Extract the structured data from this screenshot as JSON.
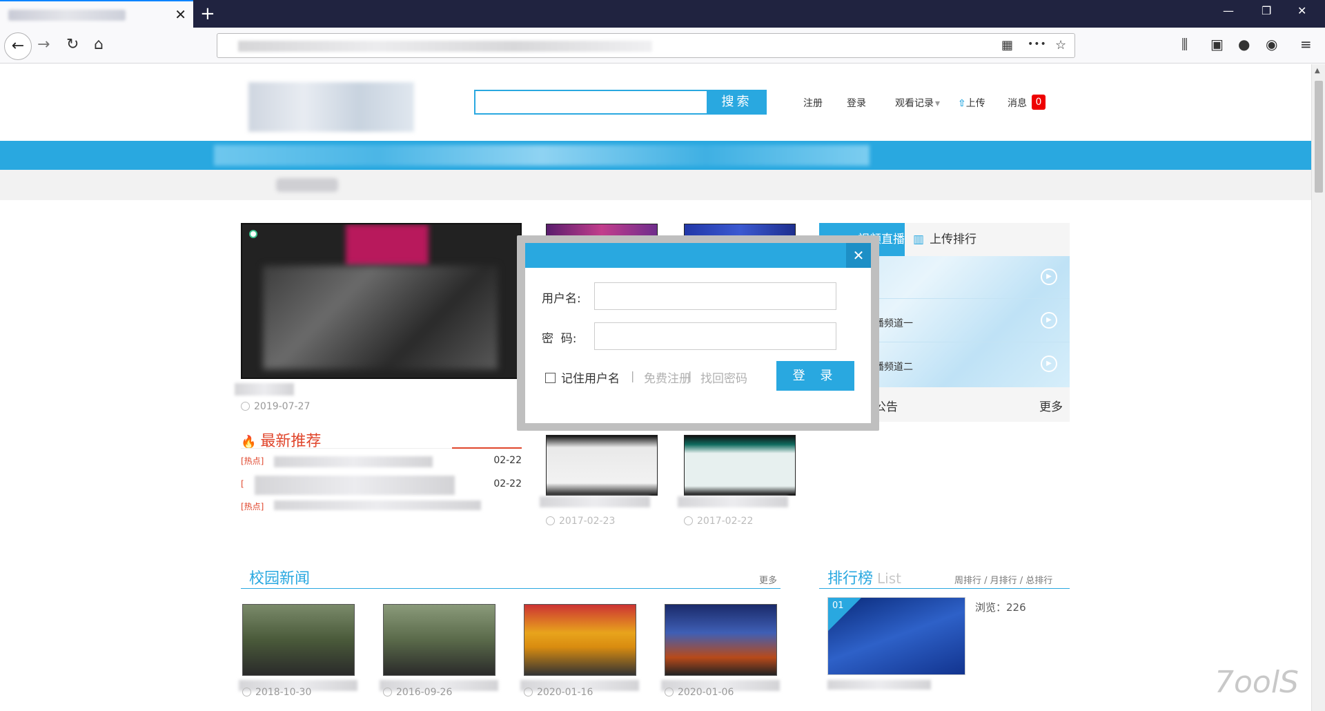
{
  "browser": {
    "new_tab_glyph": "+",
    "tab_close_glyph": "✕",
    "back_glyph": "←",
    "forward_glyph": "→",
    "reload_glyph": "↻",
    "home_glyph": "⌂",
    "more_glyph": "•••",
    "star_glyph": "☆",
    "menu_glyph": "≡"
  },
  "header": {
    "search_button": "搜索",
    "links": {
      "register": "注册",
      "login": "登录",
      "history": "观看记录",
      "history_arrow": "▾",
      "upload": "上传",
      "messages": "消息"
    },
    "message_count": "0"
  },
  "featured": {
    "date": "2019-07-27"
  },
  "recommend": {
    "title": "最新推荐",
    "items": [
      {
        "tag": "[热点]",
        "date": "02-22"
      },
      {
        "tag": "[",
        "date": "02-22"
      },
      {
        "tag": "[热点]",
        "date": ""
      }
    ]
  },
  "middle_videos": [
    {
      "date": "2017-02-23"
    },
    {
      "date": "2017-02-22"
    }
  ],
  "right_panel": {
    "tab_live": "视频直播",
    "tab_upload": "上传排行",
    "channels": [
      "",
      "播频道一",
      "播频道二"
    ],
    "notice_title": "公告",
    "notice_more": "更多"
  },
  "campus_news": {
    "title": "校园新闻",
    "more": "更多",
    "items": [
      {
        "date": "2018-10-30"
      },
      {
        "date": "2016-09-26"
      },
      {
        "date": "2020-01-16"
      },
      {
        "date": "2020-01-06"
      }
    ]
  },
  "ranking": {
    "title": "排行榜",
    "title_en": "List",
    "tabs": "周排行 / 月排行 / 总排行",
    "first_rank": "01",
    "views": "浏览：226"
  },
  "watermark": "7oolS",
  "login_modal": {
    "close_glyph": "✕",
    "username_label": "用户名:",
    "password_label": "密  码:",
    "remember": "记住用户名",
    "free_register": "免费注册",
    "find_password": "找回密码",
    "separator": "|",
    "submit": "登 录"
  }
}
